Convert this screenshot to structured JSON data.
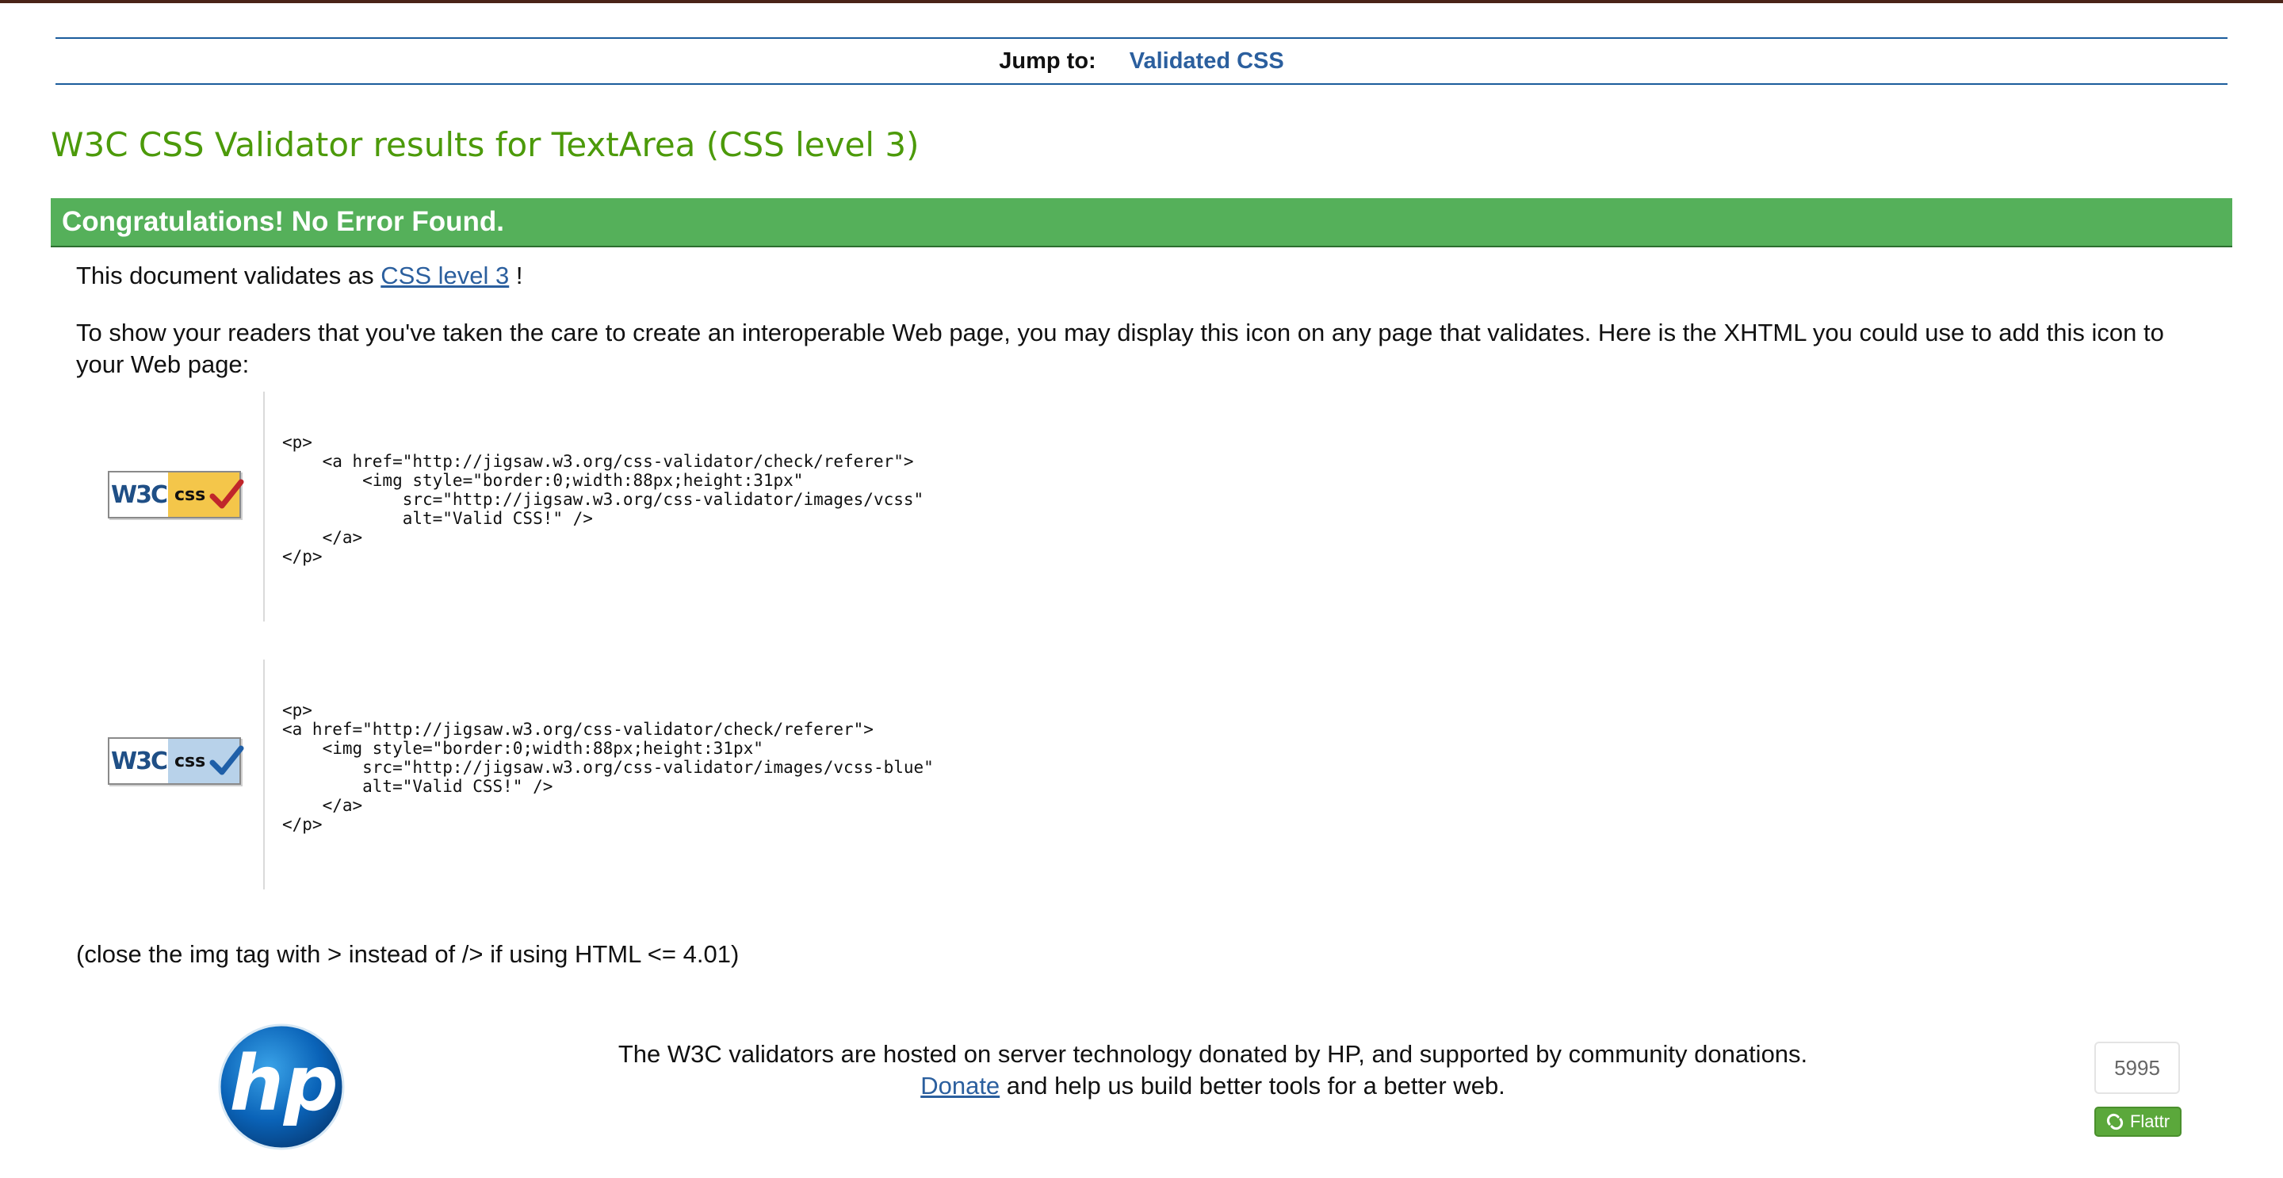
{
  "nav": {
    "jump_label": "Jump to:",
    "jump_link": "Validated CSS"
  },
  "title": "W3C CSS Validator results for TextArea (CSS level 3)",
  "congrats": "Congratulations! No Error Found.",
  "validates": {
    "prefix": "This document validates as",
    "link": "CSS level 3",
    "suffix": "!"
  },
  "show_text": "To show your readers that you've taken the care to create an interoperable Web page, you may display this icon on any page that validates. Here is the XHTML you could use to add this icon to your Web page:",
  "badges": [
    {
      "w3c": "W3C",
      "css": "css",
      "accent": "#c0262b",
      "code": "<p>\n    <a href=\"http://jigsaw.w3.org/css-validator/check/referer\">\n        <img style=\"border:0;width:88px;height:31px\"\n            src=\"http://jigsaw.w3.org/css-validator/images/vcss\"\n            alt=\"Valid CSS!\" />\n    </a>\n</p>"
    },
    {
      "w3c": "W3C",
      "css": "css",
      "accent": "#1f5fa8",
      "code": "<p>\n<a href=\"http://jigsaw.w3.org/css-validator/check/referer\">\n    <img style=\"border:0;width:88px;height:31px\"\n        src=\"http://jigsaw.w3.org/css-validator/images/vcss-blue\"\n        alt=\"Valid CSS!\" />\n    </a>\n</p>"
    }
  ],
  "close_note": "(close the img tag with > instead of /> if using HTML <= 4.01)",
  "footer": {
    "logo_text": "hp",
    "line1": "The W3C validators are hosted on server technology donated by HP, and supported by community donations.",
    "donate_link": "Donate",
    "line2_suffix": " and help us build better tools for a better web."
  },
  "flattr": {
    "count": "5995",
    "label": "Flattr",
    "color": "#5ba83b"
  },
  "colors": {
    "title": "#4c9a0a",
    "congrats_bg": "#55b05a",
    "link": "#2b5f9e",
    "rule": "#1b5c9c"
  }
}
